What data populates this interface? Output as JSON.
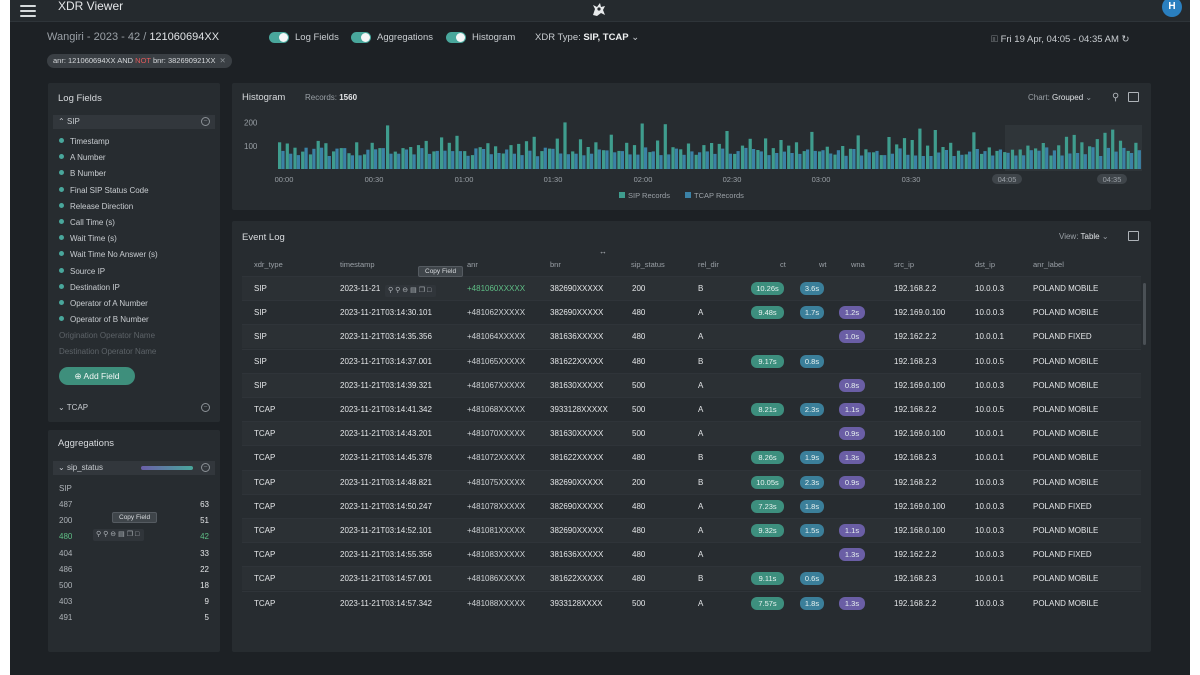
{
  "app": {
    "title": "XDR Viewer",
    "avatar_initial": "H"
  },
  "header": {
    "breadcrumb_prefix": "Wangiri - 2023 - 42 / ",
    "breadcrumb_current": "121060694XX",
    "toggles": [
      {
        "label": "Log Fields",
        "on": true
      },
      {
        "label": "Aggregations",
        "on": true
      },
      {
        "label": "Histogram",
        "on": true
      }
    ],
    "xdr_type_label": "XDR Type: ",
    "xdr_type_value": "SIP, TCAP",
    "date_range": "Fri 19 Apr, 04:05 - 04:35 AM"
  },
  "filter": {
    "anr": "anr: 121060694XX",
    "and": " AND ",
    "not": "NOT",
    "bnr": " bnr: 382690921XX"
  },
  "log_fields": {
    "title": "Log Fields",
    "sip_label": "SIP",
    "sip_fields": [
      "Timestamp",
      "A Number",
      "B Number",
      "Final SIP Status Code",
      "Release Direction",
      "Call Time (s)",
      "Wait Time (s)",
      "Wait Time No Answer (s)",
      "Source IP",
      "Destination IP",
      "Operator of A Number",
      "Operator of B Number"
    ],
    "inactive_fields": [
      "Origination Operator Name",
      "Destination Operator Name"
    ],
    "add_field_label": "Add Field",
    "tcap_label": "TCAP"
  },
  "aggregations": {
    "title": "Aggregations",
    "field": "sip_status",
    "group": "SIP",
    "tooltip": "Copy Field",
    "rows": [
      {
        "label": "487",
        "count": "63"
      },
      {
        "label": "200",
        "count": "51"
      },
      {
        "label": "480",
        "count": "42"
      },
      {
        "label": "404",
        "count": "33"
      },
      {
        "label": "486",
        "count": "22"
      },
      {
        "label": "500",
        "count": "18"
      },
      {
        "label": "403",
        "count": "9"
      },
      {
        "label": "491",
        "count": "5"
      }
    ]
  },
  "histogram": {
    "title": "Histogram",
    "records_label": "Records: ",
    "records_value": "1560",
    "chart_label": "Chart: ",
    "chart_mode": "Grouped"
  },
  "chart_data": {
    "type": "bar",
    "title": "",
    "x_ticks": [
      "00:00",
      "00:30",
      "01:00",
      "01:30",
      "02:00",
      "02:30",
      "03:00",
      "03:30",
      "04:05",
      "04:35"
    ],
    "y_ticks": [
      "200",
      "100"
    ],
    "ylim": [
      0,
      250
    ],
    "legend": "bottom-center",
    "series": [
      {
        "name": "SIP Records",
        "color": "#3f9d8e",
        "values": [
          115,
          110,
          92,
          75,
          63,
          121,
          111,
          76,
          90,
          68,
          115,
          63,
          113,
          90,
          188,
          75,
          90,
          95,
          103,
          121,
          76,
          136,
          113,
          143,
          77,
          60,
          94,
          111,
          98,
          67,
          103,
          108,
          120,
          139,
          77,
          88,
          131,
          201,
          76,
          128,
          95,
          115,
          81,
          148,
          78,
          113,
          103,
          196,
          73,
          123,
          193,
          94,
          85,
          110,
          61,
          103,
          112,
          108,
          164,
          65,
          101,
          130,
          82,
          132,
          90,
          125,
          101,
          115,
          77,
          160,
          76,
          96,
          62,
          99,
          87,
          145,
          85,
          72,
          60,
          138,
          106,
          133,
          125,
          174,
          101,
          168,
          95,
          113,
          79,
          63,
          158,
          65,
          93,
          78,
          73,
          83,
          84,
          101,
          89,
          112,
          58,
          102,
          139,
          147,
          115,
          98,
          129,
          156,
          170,
          122,
          78,
          113
        ]
      },
      {
        "name": "TCAP Records",
        "color": "#3b82a6",
        "values": [
          78,
          66,
          60,
          92,
          87,
          92,
          56,
          88,
          90,
          59,
          59,
          83,
          85,
          90,
          66,
          66,
          84,
          63,
          90,
          65,
          78,
          79,
          77,
          77,
          57,
          89,
          86,
          64,
          69,
          84,
          66,
          60,
          79,
          55,
          92,
          87,
          67,
          64,
          66,
          59,
          66,
          84,
          80,
          72,
          77,
          63,
          62,
          93,
          76,
          60,
          63,
          88,
          61,
          76,
          72,
          76,
          65,
          88,
          66,
          77,
          91,
          86,
          76,
          60,
          69,
          75,
          69,
          65,
          84,
          78,
          81,
          67,
          81,
          57,
          86,
          58,
          72,
          78,
          60,
          66,
          89,
          61,
          58,
          56,
          56,
          71,
          82,
          56,
          61,
          75,
          86,
          77,
          58,
          84,
          70,
          58,
          59,
          81,
          79,
          93,
          80,
          58,
          67,
          69,
          64,
          94,
          56,
          91,
          75,
          91,
          69,
          81
        ]
      }
    ]
  },
  "event_log": {
    "title": "Event Log",
    "view_label": "View: ",
    "view_mode": "Table",
    "tooltip": "Copy Field",
    "columns": [
      "xdr_type",
      "timestamp",
      "anr",
      "bnr",
      "sip_status",
      "rel_dir",
      "ct",
      "wt",
      "wna",
      "src_ip",
      "dst_ip",
      "anr_label"
    ],
    "rows": [
      {
        "xdr_type": "SIP",
        "timestamp": "2023-11-21",
        "anr": "+481060XXXXX",
        "bnr": "382690XXXXX",
        "sip_status": "200",
        "rel_dir": "B",
        "ct": "10.26s",
        "wt": "3.6s",
        "wna": "",
        "src_ip": "192.168.2.2",
        "dst_ip": "10.0.0.3",
        "anr_label": "POLAND MOBILE"
      },
      {
        "xdr_type": "SIP",
        "timestamp": "2023-11-21T03:14:30.101",
        "anr": "+481062XXXXX",
        "bnr": "382690XXXXX",
        "sip_status": "480",
        "rel_dir": "A",
        "ct": "9.48s",
        "wt": "1.7s",
        "wna": "1.2s",
        "src_ip": "192.169.0.100",
        "dst_ip": "10.0.0.3",
        "anr_label": "POLAND MOBILE"
      },
      {
        "xdr_type": "SIP",
        "timestamp": "2023-11-21T03:14:35.356",
        "anr": "+481064XXXXX",
        "bnr": "381636XXXXX",
        "sip_status": "480",
        "rel_dir": "A",
        "ct": "",
        "wt": "",
        "wna": "1.0s",
        "src_ip": "192.162.2.2",
        "dst_ip": "10.0.0.1",
        "anr_label": "POLAND FIXED"
      },
      {
        "xdr_type": "SIP",
        "timestamp": "2023-11-21T03:14:37.001",
        "anr": "+481065XXXXX",
        "bnr": "381622XXXXX",
        "sip_status": "480",
        "rel_dir": "B",
        "ct": "9.17s",
        "wt": "0.8s",
        "wna": "",
        "src_ip": "192.168.2.3",
        "dst_ip": "10.0.0.5",
        "anr_label": "POLAND MOBILE"
      },
      {
        "xdr_type": "SIP",
        "timestamp": "2023-11-21T03:14:39.321",
        "anr": "+481067XXXXX",
        "bnr": "381630XXXXX",
        "sip_status": "500",
        "rel_dir": "A",
        "ct": "",
        "wt": "",
        "wna": "0.8s",
        "src_ip": "192.169.0.100",
        "dst_ip": "10.0.0.3",
        "anr_label": "POLAND MOBILE"
      },
      {
        "xdr_type": "TCAP",
        "timestamp": "2023-11-21T03:14:41.342",
        "anr": "+481068XXXXX",
        "bnr": "3933128XXXXX",
        "sip_status": "500",
        "rel_dir": "A",
        "ct": "8.21s",
        "wt": "2.3s",
        "wna": "1.1s",
        "src_ip": "192.168.2.2",
        "dst_ip": "10.0.0.5",
        "anr_label": "POLAND MOBILE"
      },
      {
        "xdr_type": "TCAP",
        "timestamp": "2023-11-21T03:14:43.201",
        "anr": "+481070XXXXX",
        "bnr": "381630XXXXX",
        "sip_status": "500",
        "rel_dir": "A",
        "ct": "",
        "wt": "",
        "wna": "0.9s",
        "src_ip": "192.169.0.100",
        "dst_ip": "10.0.0.1",
        "anr_label": "POLAND MOBILE"
      },
      {
        "xdr_type": "TCAP",
        "timestamp": "2023-11-21T03:14:45.378",
        "anr": "+481072XXXXX",
        "bnr": "381622XXXXX",
        "sip_status": "480",
        "rel_dir": "B",
        "ct": "8.26s",
        "wt": "1.9s",
        "wna": "1.3s",
        "src_ip": "192.168.2.3",
        "dst_ip": "10.0.0.1",
        "anr_label": "POLAND MOBILE"
      },
      {
        "xdr_type": "TCAP",
        "timestamp": "2023-11-21T03:14:48.821",
        "anr": "+481075XXXXX",
        "bnr": "382690XXXXX",
        "sip_status": "200",
        "rel_dir": "B",
        "ct": "10.05s",
        "wt": "2.3s",
        "wna": "0.9s",
        "src_ip": "192.168.2.2",
        "dst_ip": "10.0.0.3",
        "anr_label": "POLAND MOBILE"
      },
      {
        "xdr_type": "TCAP",
        "timestamp": "2023-11-21T03:14:50.247",
        "anr": "+481078XXXXX",
        "bnr": "382690XXXXX",
        "sip_status": "480",
        "rel_dir": "A",
        "ct": "7.23s",
        "wt": "1.8s",
        "wna": "",
        "src_ip": "192.169.0.100",
        "dst_ip": "10.0.0.3",
        "anr_label": "POLAND FIXED"
      },
      {
        "xdr_type": "TCAP",
        "timestamp": "2023-11-21T03:14:52.101",
        "anr": "+481081XXXXX",
        "bnr": "382690XXXXX",
        "sip_status": "480",
        "rel_dir": "A",
        "ct": "9.32s",
        "wt": "1.5s",
        "wna": "1.1s",
        "src_ip": "192.168.0.100",
        "dst_ip": "10.0.0.3",
        "anr_label": "POLAND MOBILE"
      },
      {
        "xdr_type": "TCAP",
        "timestamp": "2023-11-21T03:14:55.356",
        "anr": "+481083XXXXX",
        "bnr": "381636XXXXX",
        "sip_status": "480",
        "rel_dir": "A",
        "ct": "",
        "wt": "",
        "wna": "1.3s",
        "src_ip": "192.162.2.2",
        "dst_ip": "10.0.0.3",
        "anr_label": "POLAND FIXED"
      },
      {
        "xdr_type": "TCAP",
        "timestamp": "2023-11-21T03:14:57.001",
        "anr": "+481086XXXXX",
        "bnr": "381622XXXXX",
        "sip_status": "480",
        "rel_dir": "B",
        "ct": "9.11s",
        "wt": "0.6s",
        "wna": "",
        "src_ip": "192.168.2.3",
        "dst_ip": "10.0.0.1",
        "anr_label": "POLAND MOBILE"
      },
      {
        "xdr_type": "TCAP",
        "timestamp": "2023-11-21T03:14:57.342",
        "anr": "+481088XXXXX",
        "bnr": "3933128XXXX",
        "sip_status": "500",
        "rel_dir": "A",
        "ct": "7.57s",
        "wt": "1.8s",
        "wna": "1.3s",
        "src_ip": "192.168.2.2",
        "dst_ip": "10.0.0.3",
        "anr_label": "POLAND MOBILE"
      }
    ]
  }
}
